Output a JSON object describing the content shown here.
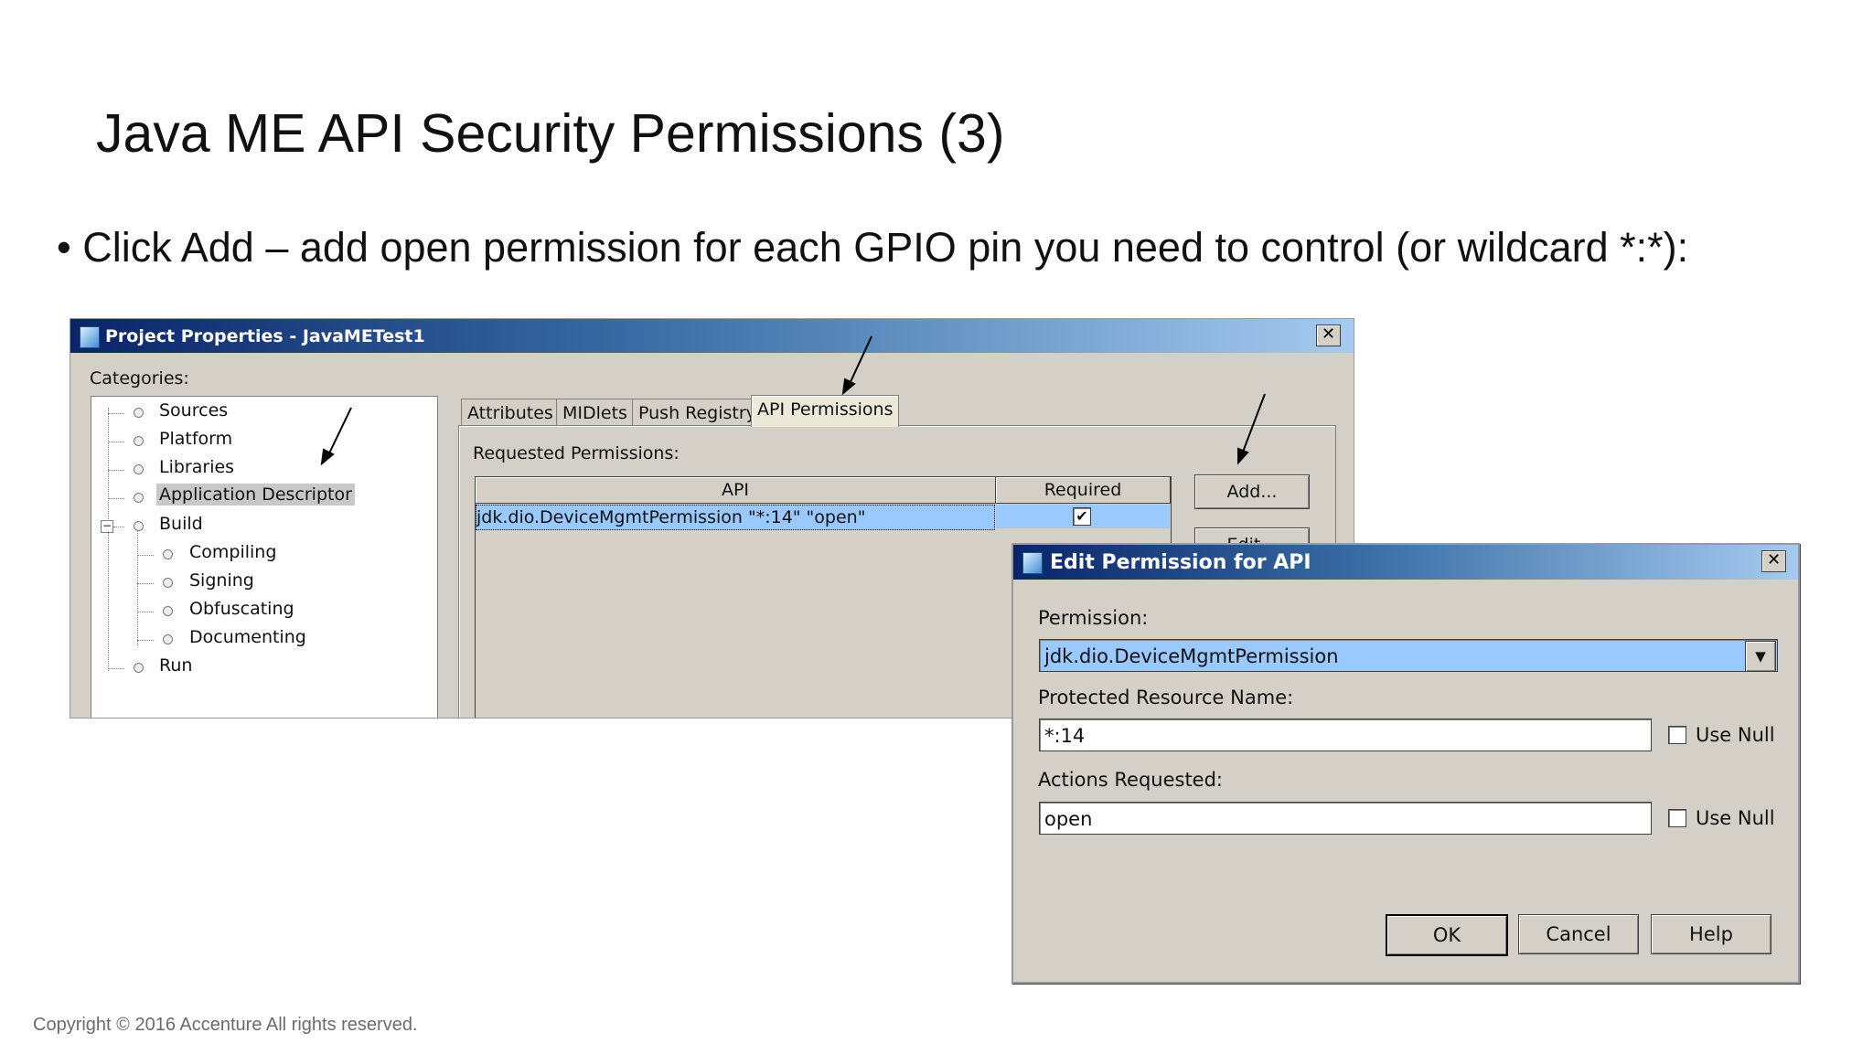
{
  "slide": {
    "title": "Java ME API Security Permissions (3)",
    "bullet": "• Click Add – add open permission for each GPIO pin you need to control (or wildcard *:*):",
    "copyright": "Copyright © 2016 Accenture  All rights reserved."
  },
  "project_window": {
    "title": "Project Properties - JavaMETest1",
    "categories_label": "Categories:",
    "tree": [
      {
        "label": "Sources"
      },
      {
        "label": "Platform"
      },
      {
        "label": "Libraries"
      },
      {
        "label": "Application Descriptor",
        "selected": true
      },
      {
        "label": "Build",
        "expanded": true
      },
      {
        "label": "Compiling"
      },
      {
        "label": "Signing"
      },
      {
        "label": "Obfuscating"
      },
      {
        "label": "Documenting"
      },
      {
        "label": "Run"
      }
    ],
    "expander": "−",
    "tabs": [
      "Attributes",
      "MIDlets",
      "Push Registry",
      "API Permissions"
    ],
    "active_tab": "API Permissions",
    "requested_permissions_label": "Requested Permissions:",
    "table": {
      "columns": [
        "API",
        "Required"
      ],
      "rows": [
        {
          "api": "jdk.dio.DeviceMgmtPermission \"*:14\" \"open\"",
          "required": true
        }
      ]
    },
    "add_button": "Add...",
    "edit_button": "Edit...",
    "close_symbol": "✕"
  },
  "edit_dialog": {
    "title": "Edit Permission for API",
    "permission_label": "Permission:",
    "permission_value": "jdk.dio.DeviceMgmtPermission",
    "resource_label": "Protected Resource Name:",
    "resource_value": "*:14",
    "actions_label": "Actions Requested:",
    "actions_value": "open",
    "use_null_label": "Use Null",
    "ok": "OK",
    "cancel": "Cancel",
    "help": "Help",
    "close_symbol": "✕",
    "dropdown_symbol": "▼"
  },
  "icons": {
    "window": "netbeans-project-icon",
    "check": "✔"
  },
  "colors": {
    "selection": "#99c9ff",
    "titlebar_start": "#0a246a",
    "titlebar_end": "#a6caf0"
  }
}
